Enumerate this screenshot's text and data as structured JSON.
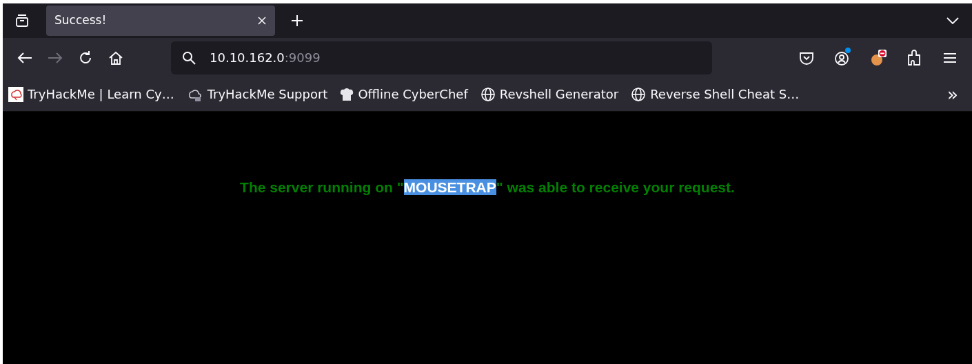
{
  "tab": {
    "title": "Success!",
    "selected": true
  },
  "address_bar": {
    "host": "10.10.162.0",
    "port": ":9099"
  },
  "toolbar": {
    "forward_disabled": true,
    "account_notification": true
  },
  "bookmarks": [
    {
      "label": "TryHackMe | Learn Cy…",
      "kind": "thm"
    },
    {
      "label": "TryHackMe Support",
      "kind": "cloud"
    },
    {
      "label": "Offline CyberChef",
      "kind": "chef"
    },
    {
      "label": "Revshell Generator",
      "kind": "globe"
    },
    {
      "label": "Reverse Shell Cheat S…",
      "kind": "globe"
    }
  ],
  "overflow": "»",
  "message": {
    "before": "The server running on \"",
    "selected_text": "MOUSETRAP",
    "after": "\" was able to receive your request."
  }
}
